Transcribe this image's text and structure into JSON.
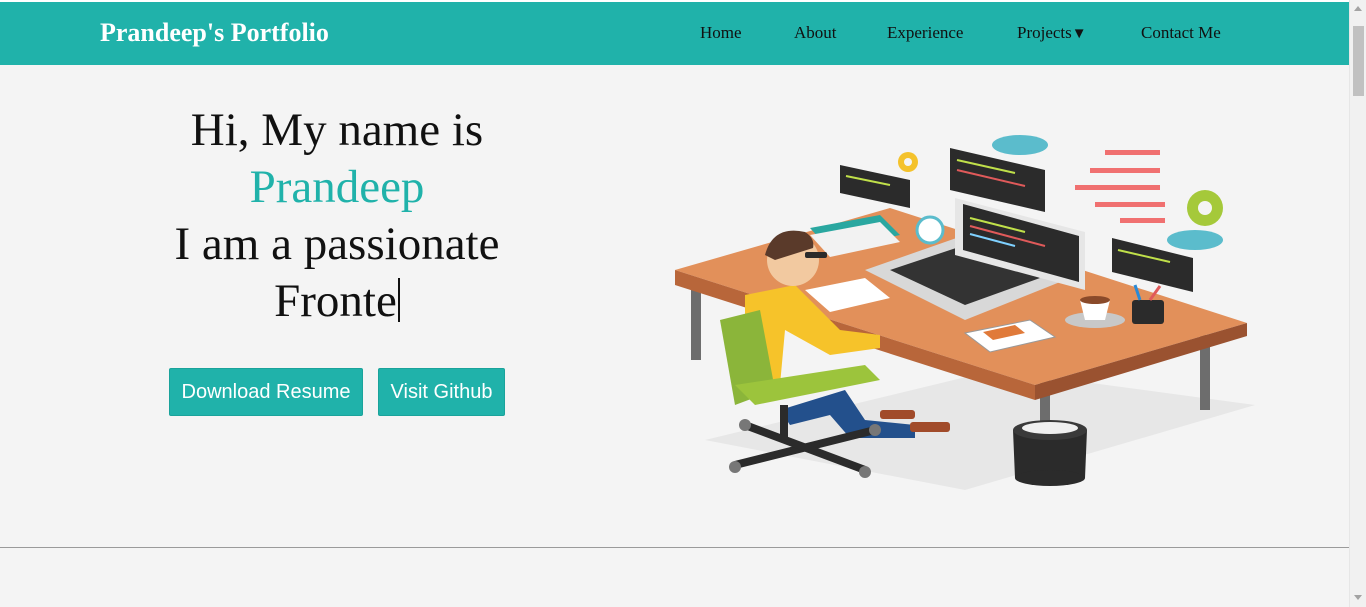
{
  "nav": {
    "brand": "Prandeep's Portfolio",
    "links": [
      "Home",
      "About",
      "Experience",
      "Projects",
      "Contact Me"
    ],
    "projects_caret": "▼"
  },
  "hero": {
    "greeting": "Hi, My name is",
    "name": "Prandeep",
    "tagline": "I am a passionate",
    "typed": "Fronte"
  },
  "buttons": {
    "resume": "Download Resume",
    "github": "Visit Github"
  },
  "illustration": {
    "subject": "developer-at-desk",
    "icons": [
      "laptop-icon",
      "monitor-icon",
      "gear-icon",
      "cloud-icon",
      "clock-icon",
      "coffee-cup-icon",
      "trash-bin-icon",
      "office-chair-icon"
    ]
  },
  "colors": {
    "accent": "#20b2aa",
    "page_bg": "#f4f4f4",
    "text": "#111111"
  }
}
